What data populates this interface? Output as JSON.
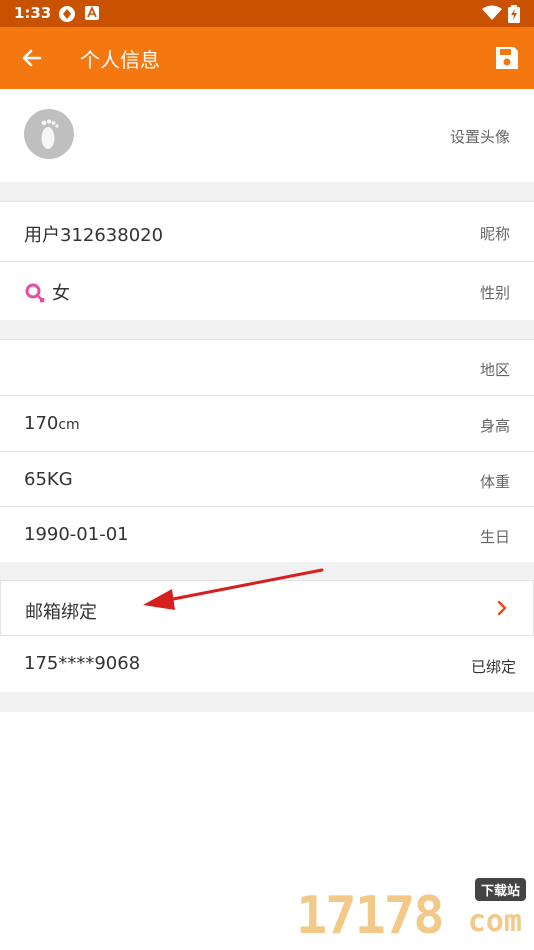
{
  "status_bar": {
    "time": "1:33"
  },
  "app_bar": {
    "title": "个人信息"
  },
  "avatar_row": {
    "label": "设置头像"
  },
  "nickname_row": {
    "value": "用户312638020",
    "label": "昵称"
  },
  "gender_row": {
    "value": "女",
    "label": "性别"
  },
  "region_row": {
    "value": "",
    "label": "地区"
  },
  "height_row": {
    "value": "170",
    "unit": "cm",
    "label": "身高"
  },
  "weight_row": {
    "value": "65KG",
    "label": "体重"
  },
  "birthday_row": {
    "value": "1990-01-01",
    "label": "生日"
  },
  "email_row": {
    "label": "邮箱绑定"
  },
  "phone_row": {
    "value": "175****9068",
    "status": "已绑定"
  },
  "watermark": {
    "number": "17178",
    "tag": "下载站",
    "domain": "com"
  },
  "colors": {
    "accent": "#f4770f",
    "status_bar": "#c95200",
    "link": "#4a9be0",
    "gender_female": "#e64ea0",
    "chevron": "#f04a1a"
  }
}
